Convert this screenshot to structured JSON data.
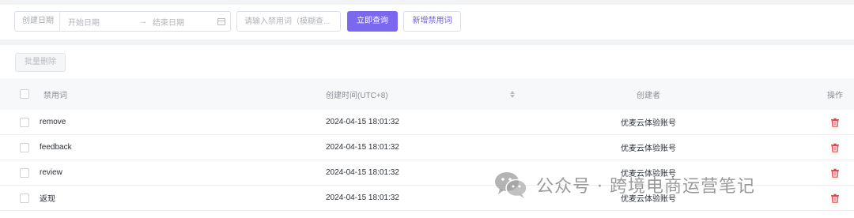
{
  "filter": {
    "date_label": "创建日期",
    "start_placeholder": "开始日期",
    "end_placeholder": "结束日期",
    "arrow": "→",
    "keyword_placeholder": "请输入禁用词（模糊查...",
    "query_button": "立即查询",
    "add_button": "新增禁用词"
  },
  "toolbar": {
    "batch_delete_button": "批量删除"
  },
  "table": {
    "columns": {
      "word": "禁用词",
      "created_time": "创建时间(UTC+8)",
      "creator": "创建者",
      "action": "操作"
    },
    "rows": [
      {
        "word": "remove",
        "created_time": "2024-04-15 18:01:32",
        "creator": "优麦云体验账号"
      },
      {
        "word": "feedback",
        "created_time": "2024-04-15 18:01:32",
        "creator": "优麦云体验账号"
      },
      {
        "word": "review",
        "created_time": "2024-04-15 18:01:32",
        "creator": "优麦云体验账号"
      },
      {
        "word": "返现",
        "created_time": "2024-04-15 18:01:32",
        "creator": "优麦云体验账号"
      }
    ]
  },
  "colors": {
    "accent": "#7b68ee",
    "delete_icon": "#e5484d"
  },
  "watermark": {
    "text": "公众号 · 跨境电商运营笔记"
  }
}
